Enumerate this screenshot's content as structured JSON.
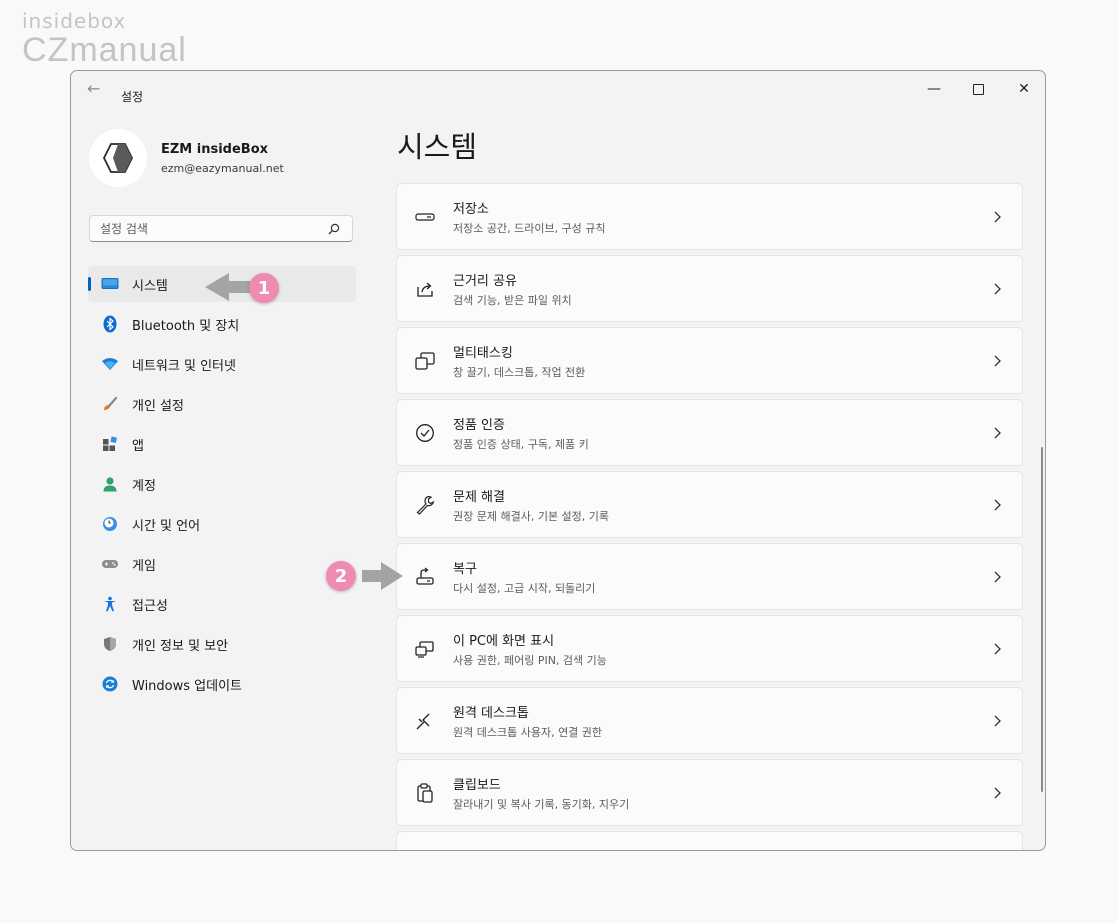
{
  "watermark": {
    "small": "insidebox",
    "big": "CZmanual"
  },
  "window": {
    "title": "설정",
    "controls": {
      "minimize": "—",
      "close": "✕"
    }
  },
  "profile": {
    "name": "EZM insideBox",
    "email": "ezm@eazymanual.net"
  },
  "search": {
    "placeholder": "설정 검색"
  },
  "nav": {
    "items": [
      {
        "label": "시스템",
        "icon": "monitor-icon",
        "selected": true
      },
      {
        "label": "Bluetooth 및 장치",
        "icon": "bluetooth-icon"
      },
      {
        "label": "네트워크 및 인터넷",
        "icon": "wifi-icon"
      },
      {
        "label": "개인 설정",
        "icon": "brush-icon"
      },
      {
        "label": "앱",
        "icon": "apps-icon"
      },
      {
        "label": "계정",
        "icon": "account-icon"
      },
      {
        "label": "시간 및 언어",
        "icon": "clock-globe-icon"
      },
      {
        "label": "게임",
        "icon": "gamepad-icon"
      },
      {
        "label": "접근성",
        "icon": "accessibility-icon"
      },
      {
        "label": "개인 정보 및 보안",
        "icon": "shield-icon"
      },
      {
        "label": "Windows 업데이트",
        "icon": "update-icon"
      }
    ]
  },
  "main": {
    "title": "시스템",
    "cards": [
      {
        "title": "저장소",
        "sub": "저장소 공간, 드라이브, 구성 규칙",
        "icon": "storage-icon"
      },
      {
        "title": "근거리 공유",
        "sub": "검색 기능, 받은 파일 위치",
        "icon": "share-icon"
      },
      {
        "title": "멀티태스킹",
        "sub": "창 끌기, 데스크톱, 작업 전환",
        "icon": "multitasking-icon"
      },
      {
        "title": "정품 인증",
        "sub": "정품 인증 상태, 구독, 제품 키",
        "icon": "activation-icon"
      },
      {
        "title": "문제 해결",
        "sub": "권장 문제 해결사, 기본 설정, 기록",
        "icon": "wrench-icon"
      },
      {
        "title": "복구",
        "sub": "다시 설정, 고급 시작, 되돌리기",
        "icon": "recovery-icon"
      },
      {
        "title": "이 PC에 화면 표시",
        "sub": "사용 권한, 페어링 PIN, 검색 기능",
        "icon": "project-icon"
      },
      {
        "title": "원격 데스크톱",
        "sub": "원격 데스크톱 사용자, 연결 권한",
        "icon": "remote-desktop-icon"
      },
      {
        "title": "클립보드",
        "sub": "잘라내기 및 복사 기록, 동기화, 지우기",
        "icon": "clipboard-icon"
      }
    ]
  },
  "annotations": {
    "badge1": "1",
    "badge2": "2"
  },
  "colors": {
    "accent": "#0067c0",
    "badge": "#f08ab2",
    "arrow": "#a0a0a0"
  }
}
